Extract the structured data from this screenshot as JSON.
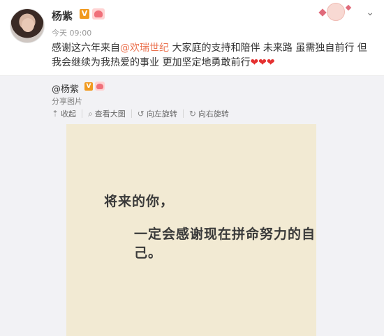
{
  "post": {
    "username": "杨紫",
    "verified_badge": "V",
    "time": "今天 09:00",
    "dropdown_icon": "chevron-down-icon",
    "text_before": "感谢这六年来自",
    "mention": "@欢瑞世纪",
    "text_after": " 大家庭的支持和陪伴 未来路 虽需独自前行 但我会继续为我热爱的事业 更加坚定地勇敢前行",
    "hearts": "❤❤❤"
  },
  "retweet": {
    "username": "@杨紫",
    "verified_badge": "V",
    "share_label": "分享图片",
    "toolbar": {
      "collapse": "收起",
      "view_large": "查看大图",
      "rotate_left": "向左旋转",
      "rotate_right": "向右旋转"
    },
    "image_text": {
      "line1": "将来的你，",
      "line2": "一定会感谢现在拼命努力的自己。"
    }
  },
  "colors": {
    "mention": "#eb7350",
    "vip_badge": "#f19a1f",
    "retweet_bg": "#f2f2f5",
    "image_bg": "#f2ead3"
  }
}
